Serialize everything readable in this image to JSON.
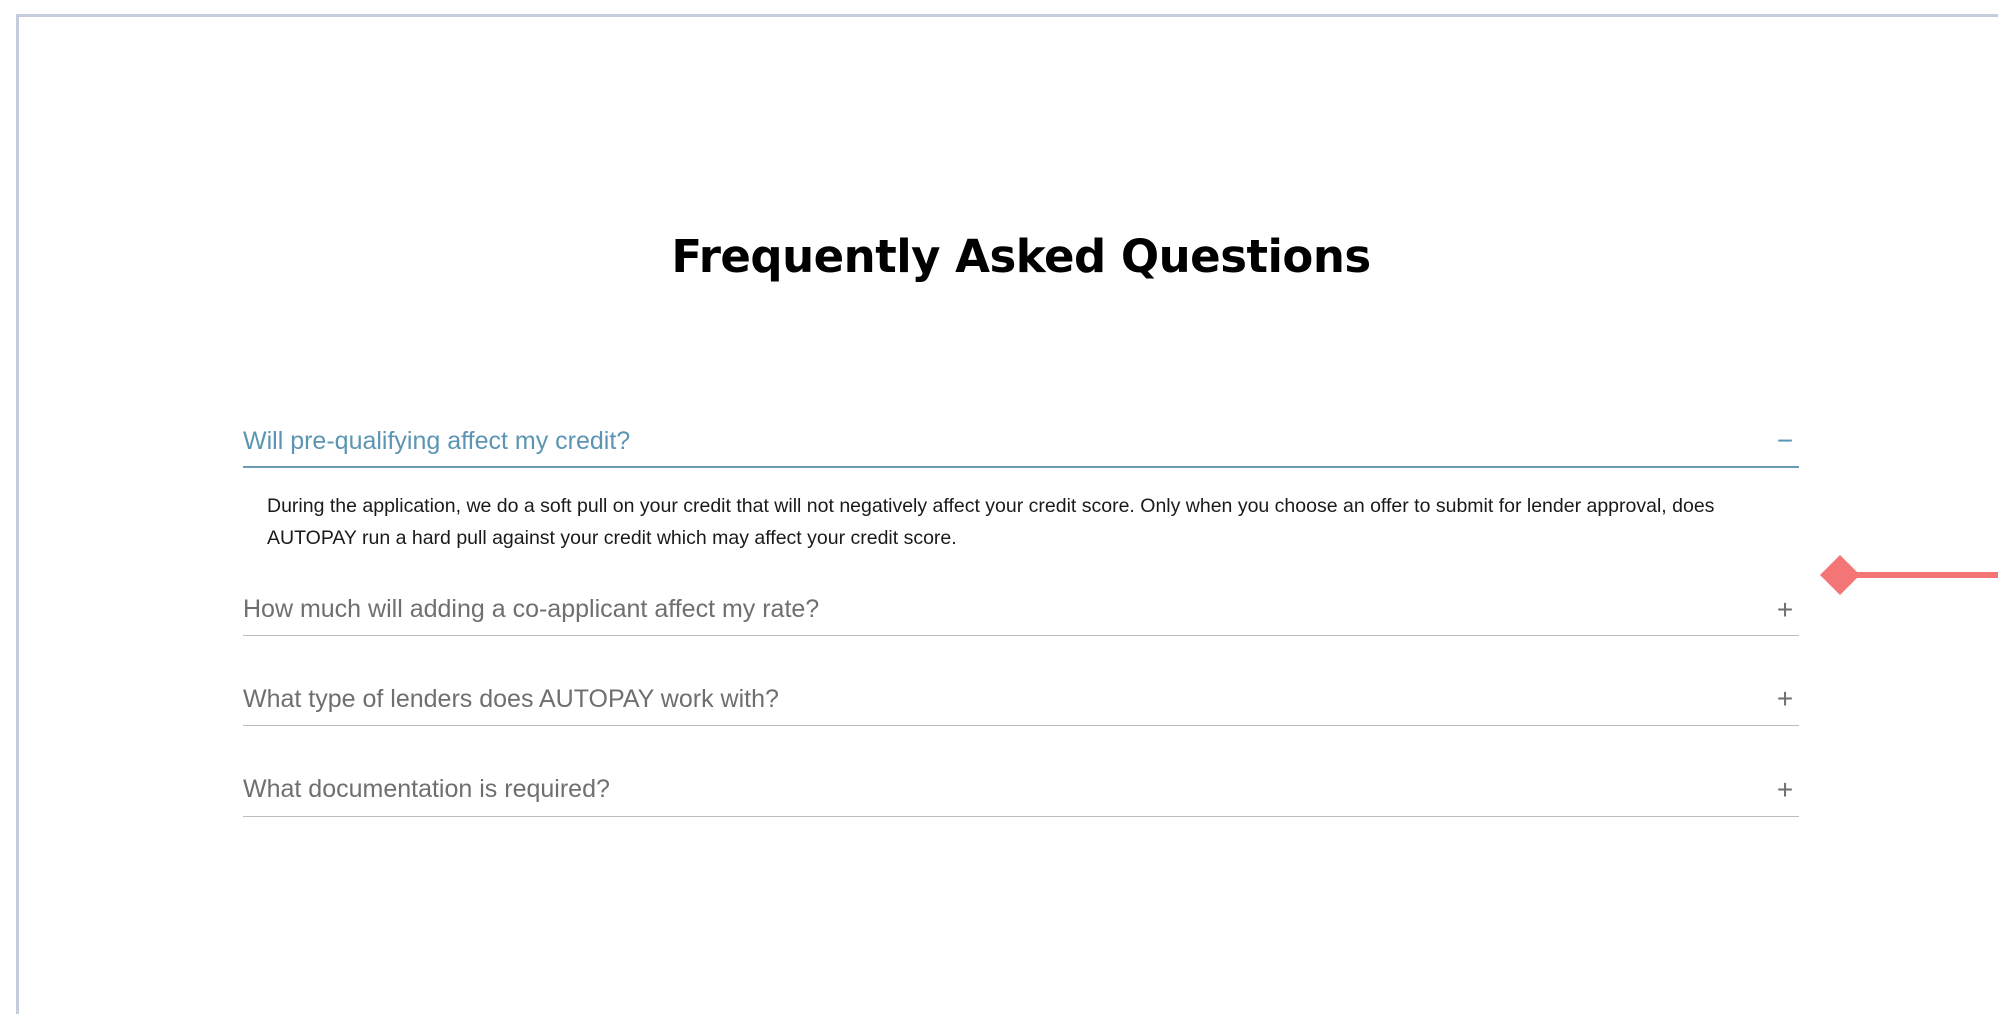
{
  "page": {
    "title": "Frequently Asked Questions"
  },
  "faq": {
    "items": [
      {
        "question": "Will pre-qualifying affect my credit?",
        "toggle": "−",
        "open": true,
        "answer": "During the application, we do a soft pull on your credit that will not negatively affect your credit score. Only when you choose an offer to submit for lender approval, does AUTOPAY run a hard pull against your credit which may affect your credit score."
      },
      {
        "question": "How much will adding a co-applicant affect my rate?",
        "toggle": "+",
        "open": false
      },
      {
        "question": "What type of lenders does AUTOPAY work with?",
        "toggle": "+",
        "open": false
      },
      {
        "question": "What documentation is required?",
        "toggle": "+",
        "open": false
      }
    ]
  },
  "colors": {
    "accent": "#5b95b3",
    "question_text": "#6f6f6f",
    "divider": "#bdbdbd",
    "pointer": "#f47575",
    "frame_border": "#c5cddc"
  },
  "icons": {
    "open_toggle": "minus-icon",
    "closed_toggle": "plus-icon",
    "pointer": "diamond-pointer-icon"
  }
}
